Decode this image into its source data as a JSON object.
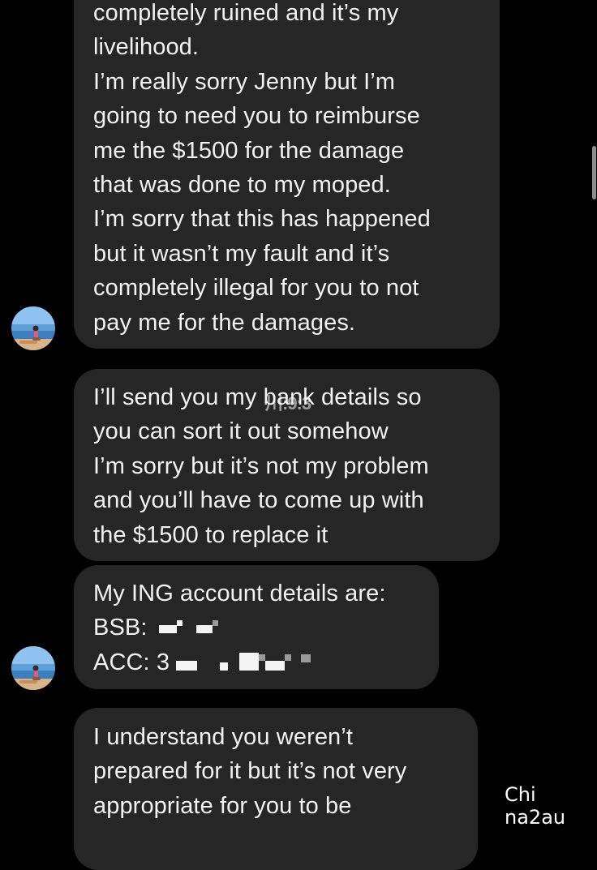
{
  "conversation": {
    "messages": [
      {
        "lines": [
          "completely ruined and it’s my",
          "livelihood.",
          "I’m really sorry Jenny but I’m",
          "going to need you to reimburse",
          "me the $1500 for the damage",
          "that was done to my moped.",
          "I’m sorry that this has happened",
          "but it wasn’t my fault and it’s",
          "completely illegal for you to not",
          "pay me for the damages."
        ]
      },
      {
        "lines": [
          "I’ll send you my bank details so",
          "you can sort it out somehow",
          "I’m sorry but it’s not my problem",
          "and you’ll have to come up with",
          "the $1500 to replace it"
        ]
      },
      {
        "lines": [
          "My ING account details are:",
          "BSB:",
          "ACC: 3"
        ]
      },
      {
        "lines": [
          "I understand you weren’t",
          "prepared for it but it’s not very",
          "appropriate for you to be"
        ]
      }
    ]
  },
  "overlay": {
    "mid_watermark": "川:9:3",
    "corner_watermark": "Chi na2au"
  },
  "colors": {
    "background": "#000000",
    "bubble": "#262626",
    "text": "#f2f2f2",
    "redaction": "#f4f4f4"
  },
  "icons": {
    "avatar": "beach-avatar-icon"
  }
}
